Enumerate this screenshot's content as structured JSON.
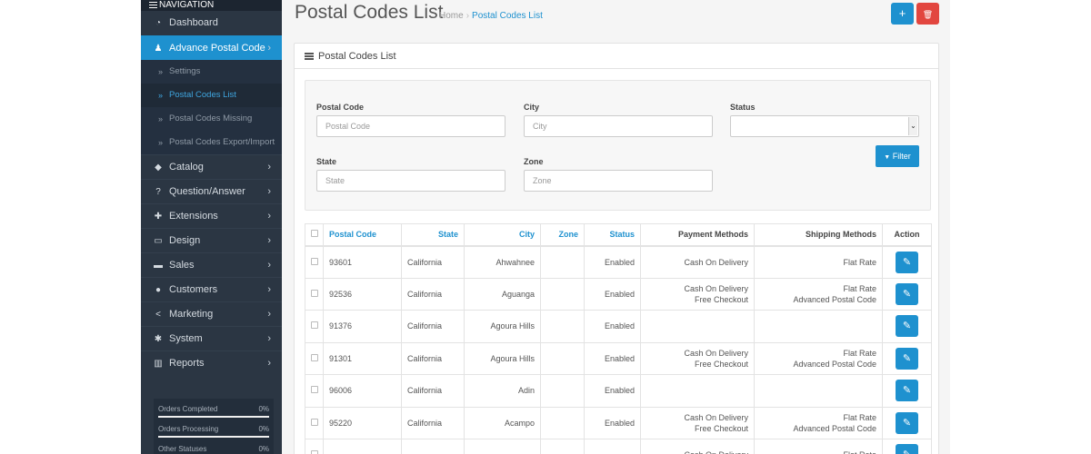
{
  "sidebar": {
    "header": "NAVIGATION",
    "menu": [
      {
        "label": "Dashboard",
        "icon": "dashboard-icon",
        "glyph": "◔",
        "chevron": ""
      },
      {
        "label": "Advance Postal Code",
        "icon": "user-icon",
        "glyph": "♟",
        "chevron": "›",
        "active": true
      },
      {
        "label": "Catalog",
        "icon": "tags-icon",
        "glyph": "◆",
        "chevron": "›"
      },
      {
        "label": "Question/Answer",
        "icon": "question-icon",
        "glyph": "?",
        "chevron": "›"
      },
      {
        "label": "Extensions",
        "icon": "puzzle-icon",
        "glyph": "✚",
        "chevron": "›"
      },
      {
        "label": "Design",
        "icon": "monitor-icon",
        "glyph": "▭",
        "chevron": "›"
      },
      {
        "label": "Sales",
        "icon": "cart-icon",
        "glyph": "▬",
        "chevron": "›"
      },
      {
        "label": "Customers",
        "icon": "customer-icon",
        "glyph": "●",
        "chevron": "›"
      },
      {
        "label": "Marketing",
        "icon": "share-icon",
        "glyph": "<",
        "chevron": "›"
      },
      {
        "label": "System",
        "icon": "cog-icon",
        "glyph": "✱",
        "chevron": "›"
      },
      {
        "label": "Reports",
        "icon": "bar-chart-icon",
        "glyph": "▥",
        "chevron": "›"
      }
    ],
    "submenu": [
      {
        "label": "Settings"
      },
      {
        "label": "Postal Codes List",
        "active": true
      },
      {
        "label": "Postal Codes Missing"
      },
      {
        "label": "Postal Codes Export/Import"
      }
    ],
    "raquo": "»",
    "stats": [
      {
        "label": "Orders Completed",
        "value": "0%",
        "progress": 0
      },
      {
        "label": "Orders Processing",
        "value": "0%",
        "progress": 0
      },
      {
        "label": "Other Statuses",
        "value": "0%",
        "progress": 0
      }
    ]
  },
  "header": {
    "title": "Postal Codes List",
    "breadcrumb_home": "Home",
    "breadcrumb_sep": "›",
    "breadcrumb_current": "Postal Codes List",
    "add_glyph": "+",
    "delete_glyph": "🗑"
  },
  "panel": {
    "title": "Postal Codes List"
  },
  "filter": {
    "postal_code_label": "Postal Code",
    "postal_code_placeholder": "Postal Code",
    "city_label": "City",
    "city_placeholder": "City",
    "status_label": "Status",
    "status_value": "",
    "state_label": "State",
    "state_placeholder": "State",
    "zone_label": "Zone",
    "zone_placeholder": "Zone",
    "button_label": "Filter",
    "button_glyph": "▼"
  },
  "table": {
    "columns": {
      "postal_code": "Postal Code",
      "state": "State",
      "city": "City",
      "zone": "Zone",
      "status": "Status",
      "payment": "Payment Methods",
      "shipping": "Shipping Methods",
      "action": "Action"
    },
    "edit_glyph": "✎",
    "rows": [
      {
        "postal_code": "93601",
        "state": "California",
        "city": "Ahwahnee",
        "zone": "",
        "status": "Enabled",
        "payment": [
          "Cash On Delivery"
        ],
        "shipping": [
          "Flat Rate"
        ]
      },
      {
        "postal_code": "92536",
        "state": "California",
        "city": "Aguanga",
        "zone": "",
        "status": "Enabled",
        "payment": [
          "Cash On Delivery",
          "Free Checkout"
        ],
        "shipping": [
          "Flat Rate",
          "Advanced Postal Code"
        ]
      },
      {
        "postal_code": "91376",
        "state": "California",
        "city": "Agoura Hills",
        "zone": "",
        "status": "Enabled",
        "payment": [],
        "shipping": []
      },
      {
        "postal_code": "91301",
        "state": "California",
        "city": "Agoura Hills",
        "zone": "",
        "status": "Enabled",
        "payment": [
          "Cash On Delivery",
          "Free Checkout"
        ],
        "shipping": [
          "Flat Rate",
          "Advanced Postal Code"
        ]
      },
      {
        "postal_code": "96006",
        "state": "California",
        "city": "Adin",
        "zone": "",
        "status": "Enabled",
        "payment": [],
        "shipping": []
      },
      {
        "postal_code": "95220",
        "state": "California",
        "city": "Acampo",
        "zone": "",
        "status": "Enabled",
        "payment": [
          "Cash On Delivery",
          "Free Checkout"
        ],
        "shipping": [
          "Flat Rate",
          "Advanced Postal Code"
        ]
      },
      {
        "postal_code": "",
        "state": "",
        "city": "",
        "zone": "",
        "status": "",
        "payment": [
          "Cash On Delivery"
        ],
        "shipping": [
          "Flat Rate"
        ]
      }
    ]
  }
}
